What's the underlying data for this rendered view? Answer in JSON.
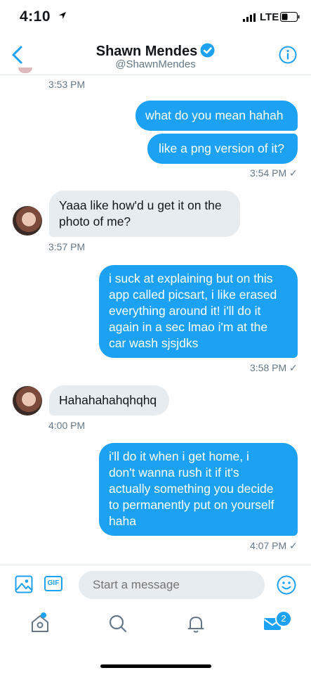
{
  "status_bar": {
    "time": "4:10",
    "network": "LTE"
  },
  "header": {
    "name": "Shawn Mendes",
    "handle": "@ShawnMendes"
  },
  "messages": [
    {
      "dir": "stamp",
      "time": "3:53 PM"
    },
    {
      "dir": "out",
      "lines": [
        "what do you mean hahah"
      ]
    },
    {
      "dir": "out",
      "lines": [
        "like a png version of it?"
      ],
      "time": "3:54 PM ✓"
    },
    {
      "dir": "in",
      "lines": [
        "Yaaa like how'd u get it on the",
        "photo of me?"
      ],
      "time": "3:57 PM"
    },
    {
      "dir": "out",
      "lines": [
        "i suck at explaining but on this",
        "app called picsart, i like erased",
        "everything around it! i'll do it",
        "again in a sec lmao i'm at the",
        "car wash sjsjdks"
      ],
      "time": "3:58 PM ✓"
    },
    {
      "dir": "in",
      "lines": [
        "Hahahahahqhqhq"
      ],
      "time": "4:00 PM"
    },
    {
      "dir": "out",
      "lines": [
        "i'll do it when i get home, i",
        "don't wanna rush it if it's",
        "actually something you decide",
        "to permanently put on yourself",
        "haha"
      ],
      "time": "4:07 PM ✓"
    }
  ],
  "composer": {
    "placeholder": "Start a message",
    "gif_label": "GIF"
  },
  "tabbar": {
    "messages_badge": "2"
  },
  "icons": {
    "back": "chevron-left-icon",
    "verified": "verified-badge-icon",
    "info": "info-icon",
    "media": "image-icon",
    "gif": "gif-icon",
    "emoji": "smiley-icon",
    "home": "home-icon",
    "search": "search-icon",
    "notifications": "bell-icon",
    "messages": "envelope-icon"
  },
  "colors": {
    "accent": "#1da1f2",
    "incoming_bubble": "#e6ecf0",
    "secondary_text": "#657786"
  }
}
